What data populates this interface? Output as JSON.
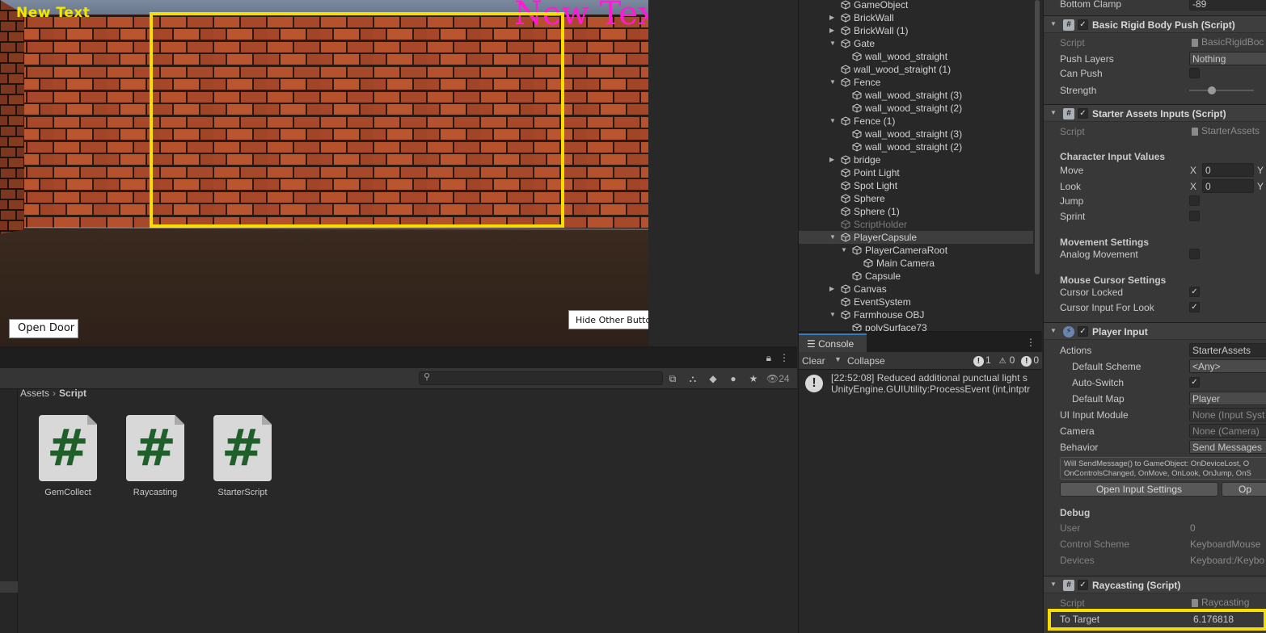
{
  "game": {
    "hud_yellow": "New Text",
    "hud_magenta": "New Text",
    "open_door": "Open Door",
    "hide_other": "Hide Other Buttons"
  },
  "project": {
    "search_placeholder": "",
    "count": "24",
    "breadcrumb": [
      "Assets",
      "Script"
    ],
    "assets": [
      "GemCollect",
      "Raycasting",
      "StarterScript"
    ]
  },
  "hierarchy": {
    "rows": [
      {
        "label": "GameObject",
        "indent": 1,
        "arrow": "none",
        "dim": false,
        "selected": false
      },
      {
        "label": "BrickWall",
        "indent": 1,
        "arrow": "right",
        "dim": false,
        "selected": false
      },
      {
        "label": "BrickWall (1)",
        "indent": 1,
        "arrow": "right",
        "dim": false,
        "selected": false
      },
      {
        "label": "Gate",
        "indent": 1,
        "arrow": "down",
        "dim": false,
        "selected": false
      },
      {
        "label": "wall_wood_straight",
        "indent": 2,
        "arrow": "none",
        "dim": false,
        "selected": false
      },
      {
        "label": "wall_wood_straight (1)",
        "indent": 1,
        "arrow": "none",
        "dim": false,
        "selected": false
      },
      {
        "label": "Fence",
        "indent": 1,
        "arrow": "down",
        "dim": false,
        "selected": false
      },
      {
        "label": "wall_wood_straight (3)",
        "indent": 2,
        "arrow": "none",
        "dim": false,
        "selected": false
      },
      {
        "label": "wall_wood_straight (2)",
        "indent": 2,
        "arrow": "none",
        "dim": false,
        "selected": false
      },
      {
        "label": "Fence (1)",
        "indent": 1,
        "arrow": "down",
        "dim": false,
        "selected": false
      },
      {
        "label": "wall_wood_straight (3)",
        "indent": 2,
        "arrow": "none",
        "dim": false,
        "selected": false
      },
      {
        "label": "wall_wood_straight (2)",
        "indent": 2,
        "arrow": "none",
        "dim": false,
        "selected": false
      },
      {
        "label": "bridge",
        "indent": 1,
        "arrow": "right",
        "dim": false,
        "selected": false
      },
      {
        "label": "Point Light",
        "indent": 1,
        "arrow": "none",
        "dim": false,
        "selected": false
      },
      {
        "label": "Spot Light",
        "indent": 1,
        "arrow": "none",
        "dim": false,
        "selected": false
      },
      {
        "label": "Sphere",
        "indent": 1,
        "arrow": "none",
        "dim": false,
        "selected": false
      },
      {
        "label": "Sphere (1)",
        "indent": 1,
        "arrow": "none",
        "dim": false,
        "selected": false
      },
      {
        "label": "ScriptHolder",
        "indent": 1,
        "arrow": "none",
        "dim": true,
        "selected": false
      },
      {
        "label": "PlayerCapsule",
        "indent": 1,
        "arrow": "down",
        "dim": false,
        "selected": true
      },
      {
        "label": "PlayerCameraRoot",
        "indent": 2,
        "arrow": "down",
        "dim": false,
        "selected": false
      },
      {
        "label": "Main Camera",
        "indent": 3,
        "arrow": "none",
        "dim": false,
        "selected": false
      },
      {
        "label": "Capsule",
        "indent": 2,
        "arrow": "none",
        "dim": false,
        "selected": false
      },
      {
        "label": "Canvas",
        "indent": 1,
        "arrow": "right",
        "dim": false,
        "selected": false
      },
      {
        "label": "EventSystem",
        "indent": 1,
        "arrow": "none",
        "dim": false,
        "selected": false
      },
      {
        "label": "Farmhouse OBJ",
        "indent": 1,
        "arrow": "down",
        "dim": false,
        "selected": false
      },
      {
        "label": "polySurface73",
        "indent": 2,
        "arrow": "none",
        "dim": false,
        "selected": false
      }
    ]
  },
  "console": {
    "tab": "Console",
    "clear": "Clear",
    "collapse": "Collapse",
    "count_info": "1",
    "count_warn": "0",
    "count_error": "0",
    "log_line1": "[22:52:08] Reduced additional punctual light s",
    "log_line2": "UnityEngine.GUIUtility:ProcessEvent (int,intptr"
  },
  "inspector": {
    "bottom_clamp_label": "Bottom Clamp",
    "bottom_clamp_value": "-89",
    "brp": {
      "title": "Basic Rigid Body Push (Script)",
      "script_label": "Script",
      "script_value": "BasicRigidBoc",
      "push_layers_label": "Push Layers",
      "push_layers_value": "Nothing",
      "can_push_label": "Can Push",
      "strength_label": "Strength",
      "strength_fraction": 0.35
    },
    "sai": {
      "title": "Starter Assets Inputs (Script)",
      "script_label": "Script",
      "script_value": "StarterAssets",
      "section_char": "Character Input Values",
      "move_label": "Move",
      "move_x": "0",
      "look_label": "Look",
      "look_x": "0",
      "x_letter": "X",
      "y_letter": "Y",
      "jump_label": "Jump",
      "sprint_label": "Sprint",
      "section_move": "Movement Settings",
      "analog_label": "Analog Movement",
      "section_cursor": "Mouse Cursor Settings",
      "cursor_locked_label": "Cursor Locked",
      "cursor_look_label": "Cursor Input For Look"
    },
    "pi": {
      "title": "Player Input",
      "actions_label": "Actions",
      "actions_value": "StarterAssets",
      "default_scheme_label": "Default Scheme",
      "default_scheme_value": "<Any>",
      "auto_switch_label": "Auto-Switch",
      "default_map_label": "Default Map",
      "default_map_value": "Player",
      "ui_module_label": "UI Input Module",
      "ui_module_value": "None (Input Syst",
      "camera_label": "Camera",
      "camera_value": "None (Camera)",
      "behavior_label": "Behavior",
      "behavior_value": "Send Messages",
      "help_line1": "Will SendMessage() to GameObject: OnDeviceLost, O",
      "help_line2": "OnControlsChanged, OnMove, OnLook, OnJump, OnS",
      "open_settings": "Open Input Settings",
      "open_debugger": "Op",
      "debug_section": "Debug",
      "user_label": "User",
      "user_value": "0",
      "control_scheme_label": "Control Scheme",
      "control_scheme_value": "KeyboardMouse",
      "devices_label": "Devices",
      "devices_value": "Keyboard:/Keybo"
    },
    "rc": {
      "title": "Raycasting (Script)",
      "script_label": "Script",
      "script_value": "Raycasting",
      "to_target_label": "To Target",
      "to_target_value": "6.176818"
    }
  }
}
